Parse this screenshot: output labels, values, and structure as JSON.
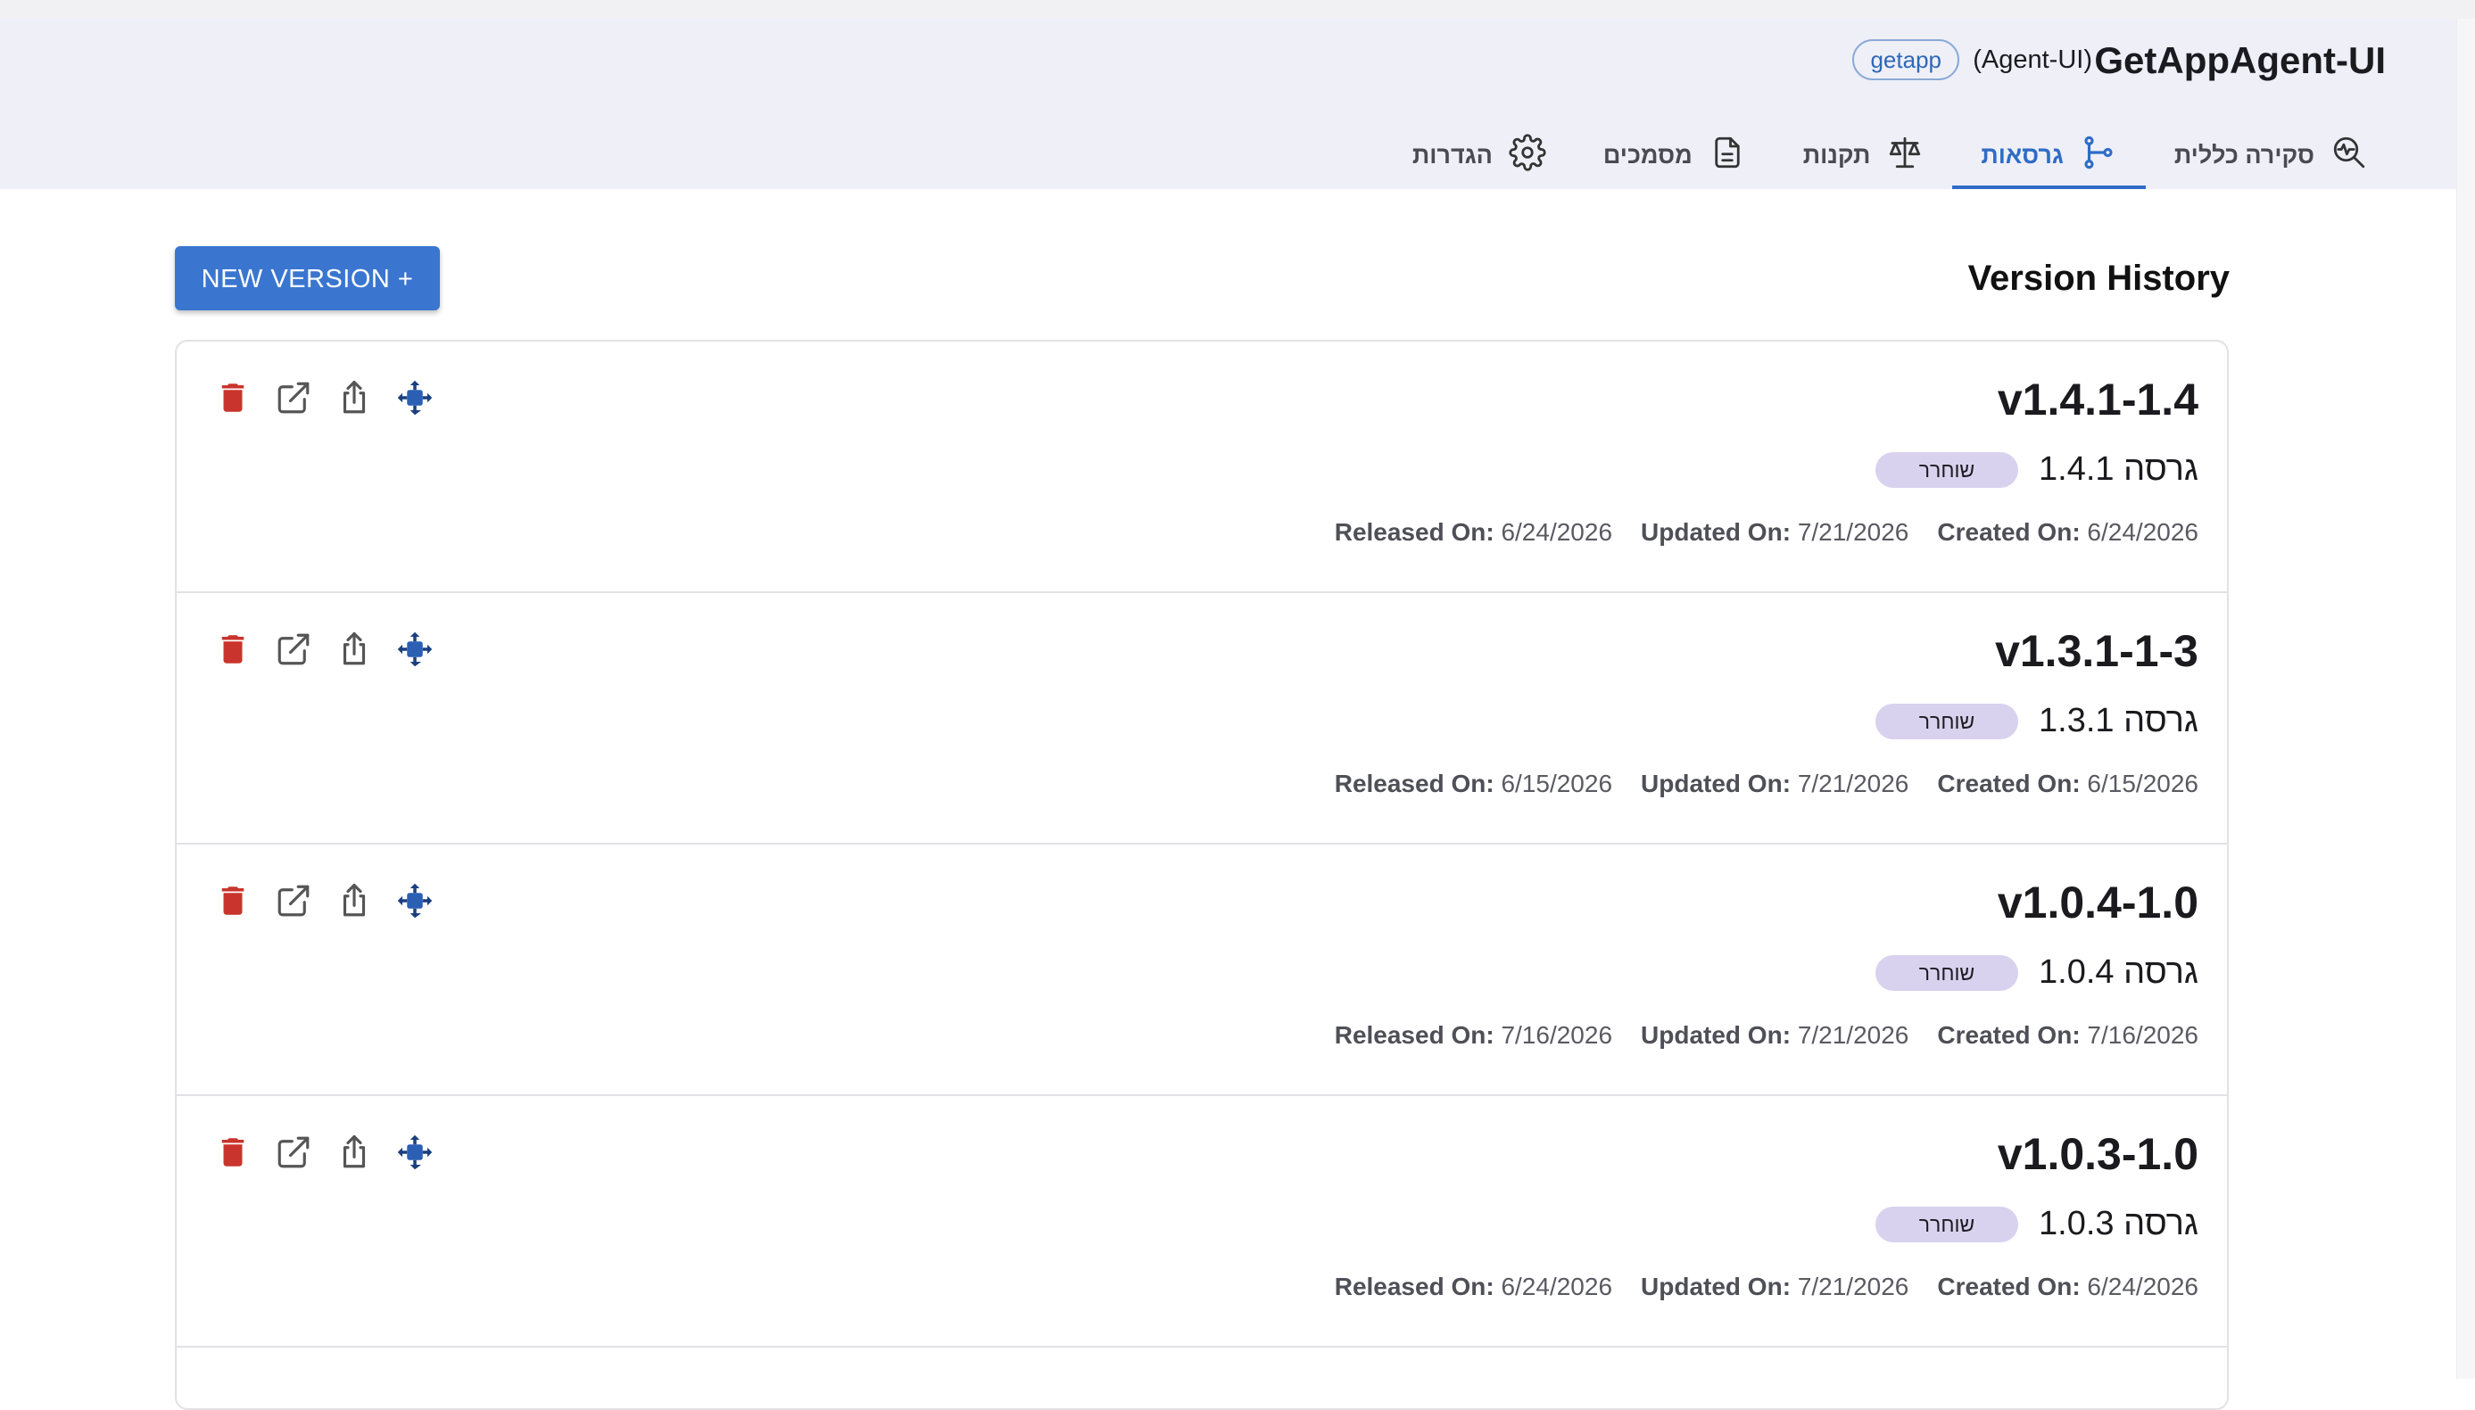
{
  "app": {
    "title": "GetAppAgent-UI",
    "subtitle": "(Agent-UI)",
    "badge": "getapp"
  },
  "tabs": [
    {
      "label": "סקירה כללית",
      "icon": "overview-chart-search-icon",
      "active": false
    },
    {
      "label": "גרסאות",
      "icon": "branch-icon",
      "active": true
    },
    {
      "label": "תקנות",
      "icon": "scales-icon",
      "active": false
    },
    {
      "label": "מסמכים",
      "icon": "document-icon",
      "active": false
    },
    {
      "label": "הגדרות",
      "icon": "gear-icon",
      "active": false
    }
  ],
  "main": {
    "title": "Version History",
    "new_button": "NEW VERSION +"
  },
  "labels": {
    "released": "Released On:",
    "updated": "Updated On:",
    "created": "Created On:"
  },
  "versions": [
    {
      "name": "v1.4.1-1.4",
      "subtitle": "גרסה 1.4.1",
      "status": "שוחרר",
      "released": "6/24/2026",
      "updated": "7/21/2026",
      "created": "6/24/2026"
    },
    {
      "name": "v1.3.1-1-3",
      "subtitle": "גרסה 1.3.1",
      "status": "שוחרר",
      "released": "6/15/2026",
      "updated": "7/21/2026",
      "created": "6/15/2026"
    },
    {
      "name": "v1.0.4-1.0",
      "subtitle": "גרסה 1.0.4",
      "status": "שוחרר",
      "released": "7/16/2026",
      "updated": "7/21/2026",
      "created": "7/16/2026"
    },
    {
      "name": "v1.0.3-1.0",
      "subtitle": "גרסה 1.0.3",
      "status": "שוחרר",
      "released": "6/24/2026",
      "updated": "7/21/2026",
      "created": "6/24/2026"
    }
  ],
  "colors": {
    "accent": "#2f6cc6",
    "header_bg": "#efeff8",
    "status_bg": "#d8d2ee",
    "delete": "#c9342c",
    "move": "#2b5fb4"
  }
}
